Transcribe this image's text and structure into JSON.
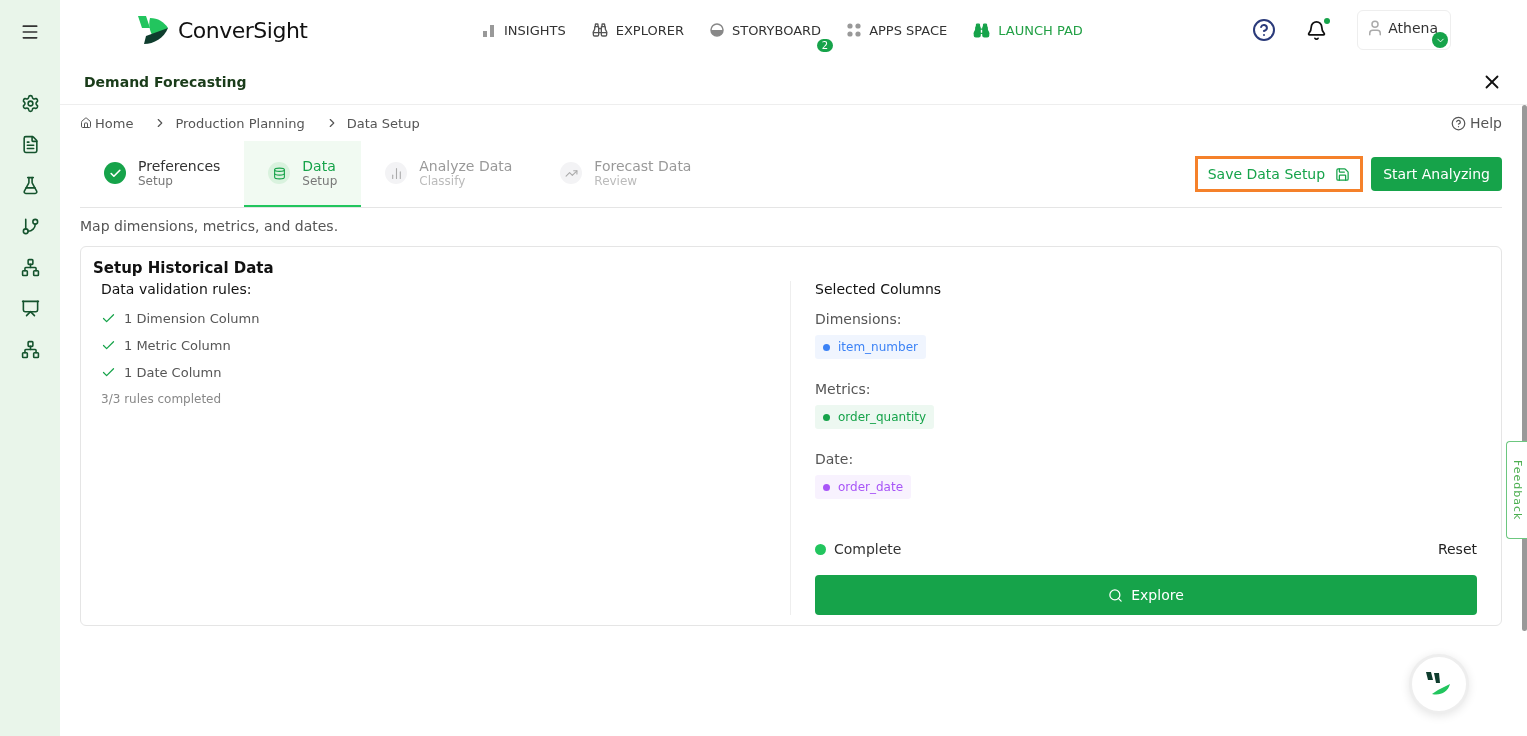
{
  "brand": {
    "name": "ConverSight"
  },
  "nav": [
    {
      "label": "INSIGHTS",
      "kind": "insights",
      "selected": false
    },
    {
      "label": "EXPLORER",
      "kind": "explorer",
      "selected": false
    },
    {
      "label": "STORYBOARD",
      "kind": "storyboard",
      "selected": false,
      "badge": "2"
    },
    {
      "label": "APPS SPACE",
      "kind": "apps",
      "selected": false
    },
    {
      "label": "LAUNCH PAD",
      "kind": "launch",
      "selected": true
    }
  ],
  "user": {
    "name": "Athena"
  },
  "sidebar": {
    "items": [
      {
        "kind": "settings"
      },
      {
        "kind": "report"
      },
      {
        "kind": "flask"
      },
      {
        "kind": "branch"
      },
      {
        "kind": "hierarchy"
      },
      {
        "kind": "presentation"
      },
      {
        "kind": "hierarchy"
      }
    ]
  },
  "panel": {
    "title": "Demand Forecasting"
  },
  "breadcrumb": [
    "Home",
    "Production Planning",
    "Data Setup"
  ],
  "help": "Help",
  "steps": [
    {
      "title": "Preferences",
      "subtitle": "Setup",
      "completed": true,
      "kind": "check",
      "selected": false
    },
    {
      "title": "Data",
      "subtitle": "Setup",
      "completed": false,
      "kind": "database",
      "selected": true
    },
    {
      "title": "Analyze Data",
      "subtitle": "Classify",
      "completed": false,
      "kind": "bars",
      "selected": false
    },
    {
      "title": "Forecast Data",
      "subtitle": "Review",
      "completed": false,
      "kind": "trend",
      "selected": false
    }
  ],
  "actions": {
    "save": {
      "label": "Save Data Setup",
      "highlighted": true
    },
    "start": "Start Analyzing"
  },
  "description": "Map dimensions, metrics, and dates.",
  "card": {
    "title": "Setup Historical Data",
    "rules_title": "Data validation rules:",
    "rules": [
      {
        "label": "1 Dimension Column",
        "checked": true
      },
      {
        "label": "1 Metric Column",
        "checked": true
      },
      {
        "label": "1 Date Column",
        "checked": true
      }
    ],
    "rules_summary": "3/3 rules completed",
    "selected_title": "Selected Columns",
    "groups": [
      {
        "label": "Dimensions:",
        "chips": [
          {
            "text": "item_number",
            "color": "#3b82f6"
          }
        ]
      },
      {
        "label": "Metrics:",
        "chips": [
          {
            "text": "order_quantity",
            "color": "#16a34a"
          }
        ]
      },
      {
        "label": "Date:",
        "chips": [
          {
            "text": "order_date",
            "color": "#a855f7"
          }
        ]
      }
    ],
    "status": {
      "label": "Complete",
      "color": "#22c55e"
    },
    "reset": "Reset",
    "explore": "Explore"
  },
  "feedback": "Feedback"
}
